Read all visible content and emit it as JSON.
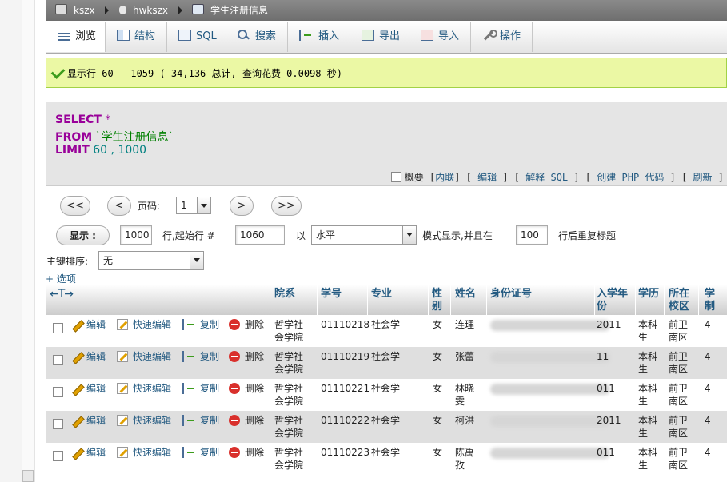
{
  "breadcrumb": {
    "server": "kszx",
    "database": "hwkszx",
    "table": "学生注册信息"
  },
  "tabs": [
    "浏览",
    "结构",
    "SQL",
    "搜索",
    "插入",
    "导出",
    "导入",
    "操作"
  ],
  "notice": "显示行 60 - 1059 ( 34,136 总计, 查询花费 0.0098 秒)",
  "sql": {
    "select_kw": "SELECT",
    "select_rest": " *",
    "from_kw": "FROM",
    "from_table": " `学生注册信息`",
    "limit_kw": "LIMIT",
    "limit_vals": " 60 , 1000"
  },
  "sql_links": {
    "profile": "概要",
    "inline": "内联",
    "edit": "编辑",
    "explain": "解释 SQL",
    "php": "创建 PHP 代码",
    "refresh": "刷新"
  },
  "nav": {
    "first": "<<",
    "prev": "<",
    "page_label": "页码:",
    "page_value": "1",
    "next": ">",
    "last": ">>"
  },
  "display": {
    "button": "显示 :",
    "rows": "1000",
    "start_label": "行,起始行 #",
    "start": "1060",
    "in_label": "以",
    "mode": "水平",
    "mode_label": "模式显示,并且在",
    "repeat": "100",
    "repeat_label": "行后重复标题"
  },
  "sort": {
    "label": "主键排序:",
    "value": "无"
  },
  "options": "+ 选项",
  "columns": [
    "院系",
    "学号",
    "专业",
    "性别",
    "姓名",
    "身份证号",
    "入学年份",
    "学历",
    "所在校区",
    "学制"
  ],
  "action_labels": {
    "edit": "编辑",
    "quick_edit": "快速编辑",
    "copy": "复制",
    "delete": "删除"
  },
  "rows": [
    {
      "dept": "哲学社会学院",
      "id": "01110218",
      "major": "社会学",
      "gender": "女",
      "name": "连理",
      "year": "2011",
      "edu": "本科生",
      "campus": "前卫南区",
      "years": "4"
    },
    {
      "dept": "哲学社会学院",
      "id": "01110219",
      "major": "社会学",
      "gender": "女",
      "name": "张蕾",
      "year": "11",
      "edu": "本科生",
      "campus": "前卫南区",
      "years": "4"
    },
    {
      "dept": "哲学社会学院",
      "id": "01110221",
      "major": "社会学",
      "gender": "女",
      "name": "林晓雯",
      "year": "011",
      "edu": "本科生",
      "campus": "前卫南区",
      "years": "4"
    },
    {
      "dept": "哲学社会学院",
      "id": "01110222",
      "major": "社会学",
      "gender": "女",
      "name": "柯洪",
      "year": "2011",
      "edu": "本科生",
      "campus": "前卫南区",
      "years": "4"
    },
    {
      "dept": "哲学社会学院",
      "id": "01110223",
      "major": "社会学",
      "gender": "女",
      "name": "陈禹孜",
      "year": "011",
      "edu": "本科生",
      "campus": "前卫南区",
      "years": "4"
    }
  ]
}
